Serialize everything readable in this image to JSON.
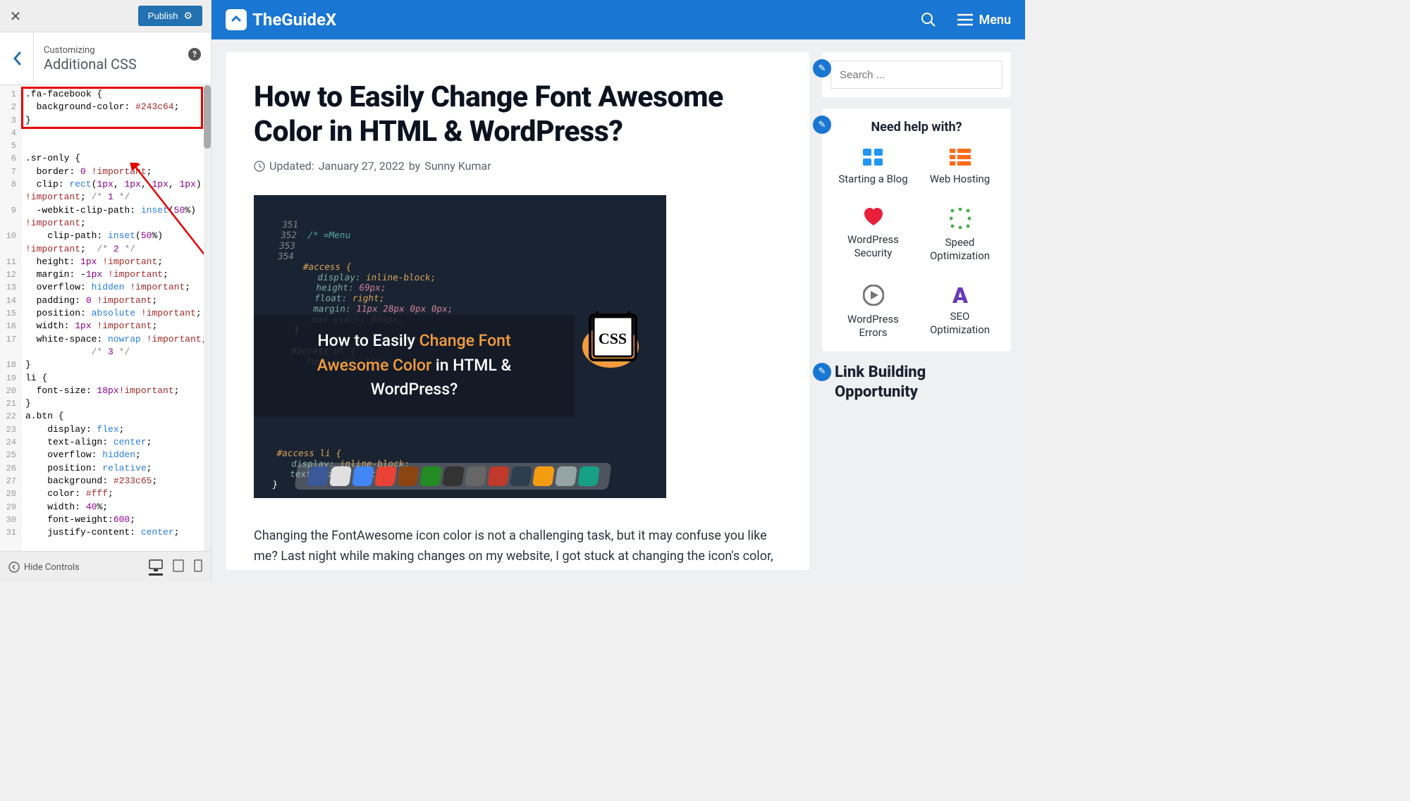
{
  "customizer": {
    "publish_label": "Publish",
    "customizing_label": "Customizing",
    "title": "Additional CSS",
    "hide_controls_label": "Hide Controls",
    "code_lines": [
      ".fa-facebook {",
      "  background-color: #243c64;",
      "}",
      "",
      "",
      ".sr-only {",
      "  border: 0 !important;",
      "  clip: rect(1px, 1px, 1px, 1px)",
      "!important; /* 1 */",
      "  -webkit-clip-path: inset(50%)",
      "!important;",
      "    clip-path: inset(50%)",
      "!important;  /* 2 */",
      "  height: 1px !important;",
      "  margin: -1px !important;",
      "  overflow: hidden !important;",
      "  padding: 0 !important;",
      "  position: absolute !important;",
      "  width: 1px !important;",
      "  white-space: nowrap !important;",
      "            /* 3 */",
      "}",
      "li {",
      "  font-size: 18px!important;",
      "}",
      "a.btn {",
      "    display: flex;",
      "    text-align: center;",
      "    overflow: hidden;",
      "    position: relative;",
      "    background: #233c65;",
      "    color: #fff;",
      "    width: 40%;",
      "    font-weight:600;",
      "    justify-content: center;"
    ],
    "line_nums": [
      "1",
      "2",
      "3",
      "4",
      "5",
      "6",
      "7",
      "8",
      "",
      "9",
      "",
      "10",
      "",
      "11",
      "12",
      "13",
      "14",
      "15",
      "16",
      "17",
      "",
      "18",
      "19",
      "20",
      "21",
      "22",
      "23",
      "24",
      "25",
      "26",
      "27",
      "28",
      "29",
      "30",
      "31"
    ]
  },
  "preview": {
    "site_name": "TheGuideX",
    "menu_label": "Menu",
    "post_title": "How to Easily Change Font Awesome Color in HTML & WordPress?",
    "updated_label": "Updated:",
    "updated_date": "January 27, 2022",
    "by_label": "by",
    "author": "Sunny Kumar",
    "featured_title_1": "How to Easily ",
    "featured_title_2": "Change Font Awesome Color",
    "featured_title_3": " in HTML & WordPress?",
    "css_badge": "CSS",
    "body_text": "Changing the FontAwesome icon color is not a challenging task, but it may confuse you like me? Last night while making changes on my website, I got stuck at changing the icon's color, even when I have already done it before.",
    "search_placeholder": "Search ...",
    "help_title": "Need help with?",
    "help_items": [
      {
        "label": "Starting a Blog",
        "color": "#2196f3"
      },
      {
        "label": "Web Hosting",
        "color": "#ff6b1a"
      },
      {
        "label": "WordPress Security",
        "color": "#e91e3a"
      },
      {
        "label": "Speed Optimization",
        "color": "#4caf50"
      },
      {
        "label": "WordPress Errors",
        "color": "#757575"
      },
      {
        "label": "SEO Optimization",
        "color": "#673ab7"
      }
    ],
    "link_widget_title": "Link Building Opportunity"
  }
}
